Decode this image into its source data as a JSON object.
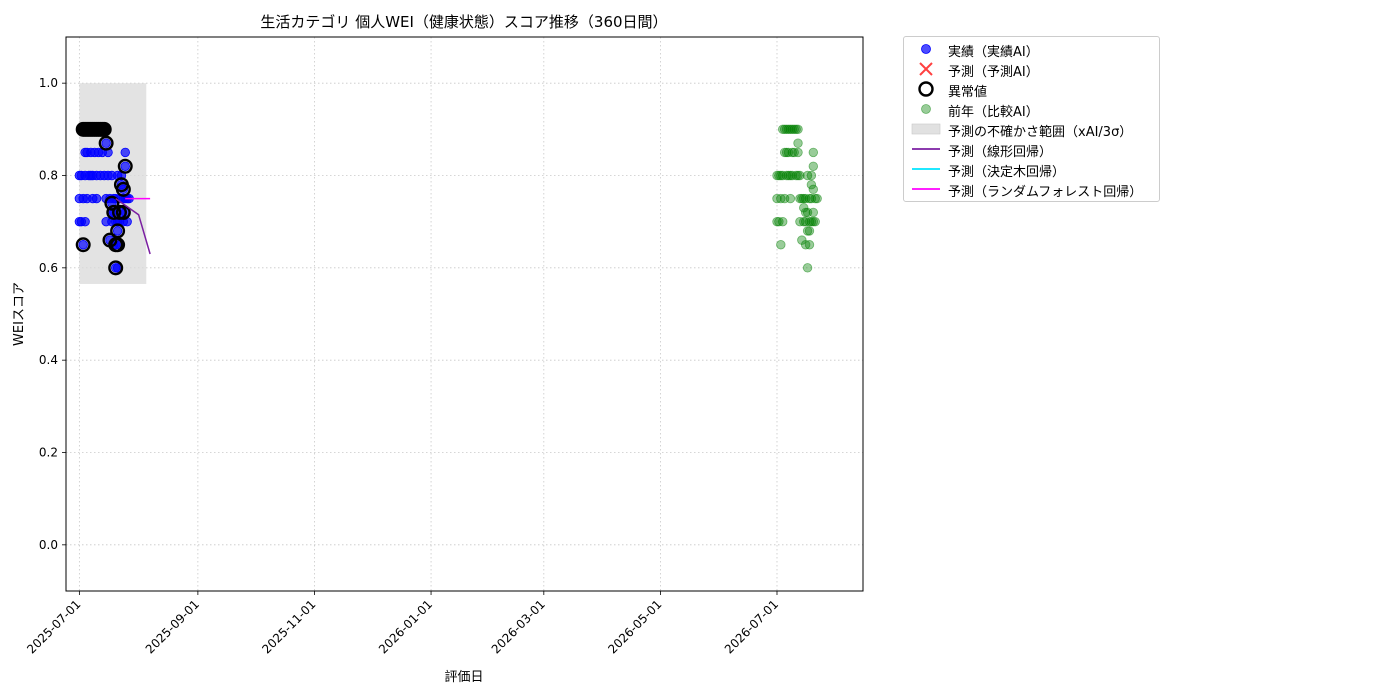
{
  "chart_data": {
    "type": "scatter",
    "title": "生活カテゴリ 個人WEI（健康状態）スコア推移（360日間）",
    "xlabel": "評価日",
    "ylabel": "WEIスコア",
    "xlim": [
      "2025-06-24",
      "2026-08-15"
    ],
    "ylim": [
      -0.1,
      1.1
    ],
    "x_ticks": [
      "2025-07-01",
      "2025-09-01",
      "2025-11-01",
      "2026-01-01",
      "2026-03-01",
      "2026-05-01",
      "2026-07-01"
    ],
    "y_ticks": [
      0.0,
      0.2,
      0.4,
      0.6,
      0.8,
      1.0
    ],
    "y_tick_labels": [
      "0.0",
      "0.2",
      "0.4",
      "0.6",
      "0.8",
      "1.0"
    ],
    "grid": true,
    "legend_position": "outside-top-right",
    "colors": {
      "actual": "#0000ff",
      "predicted": "#ff0000",
      "anomaly_edge": "#000000",
      "previous_year": "#008000",
      "uncertainty": "#d9d9d9",
      "linear": "#7b1fa2",
      "decision_tree": "#00e5ff",
      "random_forest": "#ff00ff"
    },
    "legend": [
      {
        "key": "actual",
        "label": "実績（実績AI）"
      },
      {
        "key": "predicted",
        "label": "予測（予測AI）"
      },
      {
        "key": "anomaly",
        "label": "異常値"
      },
      {
        "key": "previous_year",
        "label": "前年（比較AI）"
      },
      {
        "key": "uncertainty",
        "label": "予測の不確かさ範囲（xAI/3σ）"
      },
      {
        "key": "linear",
        "label": "予測（線形回帰）"
      },
      {
        "key": "decision_tree",
        "label": "予測（決定木回帰）"
      },
      {
        "key": "random_forest",
        "label": "予測（ランダムフォレスト回帰）"
      }
    ],
    "uncertainty_band": {
      "x_start": "2025-07-01",
      "x_end": "2025-08-05",
      "y_low": 0.565,
      "y_high": 1.0
    },
    "actual": [
      {
        "date": "2025-07-01",
        "value": 0.8
      },
      {
        "date": "2025-07-01",
        "value": 0.75
      },
      {
        "date": "2025-07-01",
        "value": 0.7
      },
      {
        "date": "2025-07-02",
        "value": 0.9
      },
      {
        "date": "2025-07-02",
        "value": 0.8
      },
      {
        "date": "2025-07-02",
        "value": 0.7
      },
      {
        "date": "2025-07-03",
        "value": 0.9
      },
      {
        "date": "2025-07-03",
        "value": 0.75
      },
      {
        "date": "2025-07-03",
        "value": 0.65
      },
      {
        "date": "2025-07-04",
        "value": 0.85
      },
      {
        "date": "2025-07-04",
        "value": 0.8
      },
      {
        "date": "2025-07-04",
        "value": 0.7
      },
      {
        "date": "2025-07-05",
        "value": 0.9
      },
      {
        "date": "2025-07-05",
        "value": 0.85
      },
      {
        "date": "2025-07-05",
        "value": 0.75
      },
      {
        "date": "2025-07-06",
        "value": 0.9
      },
      {
        "date": "2025-07-06",
        "value": 0.8
      },
      {
        "date": "2025-07-07",
        "value": 0.85
      },
      {
        "date": "2025-07-07",
        "value": 0.8
      },
      {
        "date": "2025-07-08",
        "value": 0.9
      },
      {
        "date": "2025-07-08",
        "value": 0.8
      },
      {
        "date": "2025-07-08",
        "value": 0.75
      },
      {
        "date": "2025-07-09",
        "value": 0.9
      },
      {
        "date": "2025-07-09",
        "value": 0.85
      },
      {
        "date": "2025-07-10",
        "value": 0.9
      },
      {
        "date": "2025-07-10",
        "value": 0.8
      },
      {
        "date": "2025-07-10",
        "value": 0.75
      },
      {
        "date": "2025-07-11",
        "value": 0.9
      },
      {
        "date": "2025-07-11",
        "value": 0.85
      },
      {
        "date": "2025-07-12",
        "value": 0.9
      },
      {
        "date": "2025-07-12",
        "value": 0.8
      },
      {
        "date": "2025-07-13",
        "value": 0.9
      },
      {
        "date": "2025-07-13",
        "value": 0.85
      },
      {
        "date": "2025-07-14",
        "value": 0.9
      },
      {
        "date": "2025-07-14",
        "value": 0.8
      },
      {
        "date": "2025-07-15",
        "value": 0.9
      },
      {
        "date": "2025-07-15",
        "value": 0.87
      },
      {
        "date": "2025-07-15",
        "value": 0.75
      },
      {
        "date": "2025-07-15",
        "value": 0.7
      },
      {
        "date": "2025-07-16",
        "value": 0.85
      },
      {
        "date": "2025-07-16",
        "value": 0.8
      },
      {
        "date": "2025-07-17",
        "value": 0.75
      },
      {
        "date": "2025-07-17",
        "value": 0.66
      },
      {
        "date": "2025-07-18",
        "value": 0.8
      },
      {
        "date": "2025-07-18",
        "value": 0.74
      },
      {
        "date": "2025-07-18",
        "value": 0.72
      },
      {
        "date": "2025-07-18",
        "value": 0.7
      },
      {
        "date": "2025-07-19",
        "value": 0.75
      },
      {
        "date": "2025-07-19",
        "value": 0.72
      },
      {
        "date": "2025-07-19",
        "value": 0.65
      },
      {
        "date": "2025-07-20",
        "value": 0.75
      },
      {
        "date": "2025-07-20",
        "value": 0.7
      },
      {
        "date": "2025-07-20",
        "value": 0.65
      },
      {
        "date": "2025-07-20",
        "value": 0.6
      },
      {
        "date": "2025-07-21",
        "value": 0.8
      },
      {
        "date": "2025-07-21",
        "value": 0.7
      },
      {
        "date": "2025-07-21",
        "value": 0.68
      },
      {
        "date": "2025-07-21",
        "value": 0.6
      },
      {
        "date": "2025-07-22",
        "value": 0.75
      },
      {
        "date": "2025-07-22",
        "value": 0.7
      },
      {
        "date": "2025-07-22",
        "value": 0.65
      },
      {
        "date": "2025-07-23",
        "value": 0.8
      },
      {
        "date": "2025-07-23",
        "value": 0.78
      },
      {
        "date": "2025-07-23",
        "value": 0.72
      },
      {
        "date": "2025-07-24",
        "value": 0.77
      },
      {
        "date": "2025-07-24",
        "value": 0.75
      },
      {
        "date": "2025-07-24",
        "value": 0.7
      },
      {
        "date": "2025-07-25",
        "value": 0.85
      },
      {
        "date": "2025-07-25",
        "value": 0.82
      },
      {
        "date": "2025-07-25",
        "value": 0.75
      },
      {
        "date": "2025-07-25",
        "value": 0.72
      },
      {
        "date": "2025-07-26",
        "value": 0.75
      },
      {
        "date": "2025-07-26",
        "value": 0.7
      },
      {
        "date": "2025-07-27",
        "value": 0.75
      }
    ],
    "anomalies": [
      {
        "date": "2025-07-03",
        "value": 0.65
      },
      {
        "date": "2025-07-03",
        "value": 0.9
      },
      {
        "date": "2025-07-04",
        "value": 0.9
      },
      {
        "date": "2025-07-05",
        "value": 0.9
      },
      {
        "date": "2025-07-06",
        "value": 0.9
      },
      {
        "date": "2025-07-07",
        "value": 0.9
      },
      {
        "date": "2025-07-08",
        "value": 0.9
      },
      {
        "date": "2025-07-09",
        "value": 0.9
      },
      {
        "date": "2025-07-10",
        "value": 0.9
      },
      {
        "date": "2025-07-11",
        "value": 0.9
      },
      {
        "date": "2025-07-12",
        "value": 0.9
      },
      {
        "date": "2025-07-13",
        "value": 0.9
      },
      {
        "date": "2025-07-14",
        "value": 0.9
      },
      {
        "date": "2025-07-15",
        "value": 0.87
      },
      {
        "date": "2025-07-17",
        "value": 0.66
      },
      {
        "date": "2025-07-18",
        "value": 0.74
      },
      {
        "date": "2025-07-19",
        "value": 0.72
      },
      {
        "date": "2025-07-20",
        "value": 0.65
      },
      {
        "date": "2025-07-20",
        "value": 0.6
      },
      {
        "date": "2025-07-21",
        "value": 0.68
      },
      {
        "date": "2025-07-21",
        "value": 0.65
      },
      {
        "date": "2025-07-22",
        "value": 0.72
      },
      {
        "date": "2025-07-23",
        "value": 0.78
      },
      {
        "date": "2025-07-24",
        "value": 0.77
      },
      {
        "date": "2025-07-24",
        "value": 0.72
      },
      {
        "date": "2025-07-25",
        "value": 0.82
      }
    ],
    "linear_regression": [
      {
        "date": "2025-07-20",
        "value": 0.75
      },
      {
        "date": "2025-08-01",
        "value": 0.715
      },
      {
        "date": "2025-08-07",
        "value": 0.63
      }
    ],
    "random_forest": [
      {
        "date": "2025-07-25",
        "value": 0.75
      },
      {
        "date": "2025-08-07",
        "value": 0.75
      }
    ],
    "previous_year": [
      {
        "date": "2026-07-01",
        "value": 0.8
      },
      {
        "date": "2026-07-01",
        "value": 0.75
      },
      {
        "date": "2026-07-01",
        "value": 0.7
      },
      {
        "date": "2026-07-02",
        "value": 0.8
      },
      {
        "date": "2026-07-02",
        "value": 0.7
      },
      {
        "date": "2026-07-03",
        "value": 0.8
      },
      {
        "date": "2026-07-03",
        "value": 0.75
      },
      {
        "date": "2026-07-03",
        "value": 0.65
      },
      {
        "date": "2026-07-04",
        "value": 0.9
      },
      {
        "date": "2026-07-04",
        "value": 0.8
      },
      {
        "date": "2026-07-04",
        "value": 0.7
      },
      {
        "date": "2026-07-05",
        "value": 0.9
      },
      {
        "date": "2026-07-05",
        "value": 0.85
      },
      {
        "date": "2026-07-05",
        "value": 0.75
      },
      {
        "date": "2026-07-06",
        "value": 0.9
      },
      {
        "date": "2026-07-06",
        "value": 0.85
      },
      {
        "date": "2026-07-06",
        "value": 0.8
      },
      {
        "date": "2026-07-07",
        "value": 0.9
      },
      {
        "date": "2026-07-07",
        "value": 0.85
      },
      {
        "date": "2026-07-07",
        "value": 0.8
      },
      {
        "date": "2026-07-08",
        "value": 0.9
      },
      {
        "date": "2026-07-08",
        "value": 0.8
      },
      {
        "date": "2026-07-08",
        "value": 0.75
      },
      {
        "date": "2026-07-09",
        "value": 0.9
      },
      {
        "date": "2026-07-09",
        "value": 0.85
      },
      {
        "date": "2026-07-09",
        "value": 0.8
      },
      {
        "date": "2026-07-10",
        "value": 0.9
      },
      {
        "date": "2026-07-10",
        "value": 0.85
      },
      {
        "date": "2026-07-11",
        "value": 0.9
      },
      {
        "date": "2026-07-11",
        "value": 0.8
      },
      {
        "date": "2026-07-12",
        "value": 0.9
      },
      {
        "date": "2026-07-12",
        "value": 0.87
      },
      {
        "date": "2026-07-12",
        "value": 0.85
      },
      {
        "date": "2026-07-12",
        "value": 0.8
      },
      {
        "date": "2026-07-13",
        "value": 0.8
      },
      {
        "date": "2026-07-13",
        "value": 0.75
      },
      {
        "date": "2026-07-13",
        "value": 0.7
      },
      {
        "date": "2026-07-14",
        "value": 0.75
      },
      {
        "date": "2026-07-14",
        "value": 0.66
      },
      {
        "date": "2026-07-15",
        "value": 0.75
      },
      {
        "date": "2026-07-15",
        "value": 0.73
      },
      {
        "date": "2026-07-15",
        "value": 0.7
      },
      {
        "date": "2026-07-16",
        "value": 0.75
      },
      {
        "date": "2026-07-16",
        "value": 0.72
      },
      {
        "date": "2026-07-16",
        "value": 0.7
      },
      {
        "date": "2026-07-16",
        "value": 0.65
      },
      {
        "date": "2026-07-17",
        "value": 0.8
      },
      {
        "date": "2026-07-17",
        "value": 0.72
      },
      {
        "date": "2026-07-17",
        "value": 0.68
      },
      {
        "date": "2026-07-17",
        "value": 0.6
      },
      {
        "date": "2026-07-18",
        "value": 0.75
      },
      {
        "date": "2026-07-18",
        "value": 0.7
      },
      {
        "date": "2026-07-18",
        "value": 0.68
      },
      {
        "date": "2026-07-18",
        "value": 0.65
      },
      {
        "date": "2026-07-19",
        "value": 0.8
      },
      {
        "date": "2026-07-19",
        "value": 0.78
      },
      {
        "date": "2026-07-19",
        "value": 0.75
      },
      {
        "date": "2026-07-19",
        "value": 0.7
      },
      {
        "date": "2026-07-20",
        "value": 0.85
      },
      {
        "date": "2026-07-20",
        "value": 0.82
      },
      {
        "date": "2026-07-20",
        "value": 0.77
      },
      {
        "date": "2026-07-20",
        "value": 0.72
      },
      {
        "date": "2026-07-20",
        "value": 0.7
      },
      {
        "date": "2026-07-21",
        "value": 0.75
      },
      {
        "date": "2026-07-21",
        "value": 0.7
      },
      {
        "date": "2026-07-22",
        "value": 0.75
      }
    ]
  }
}
